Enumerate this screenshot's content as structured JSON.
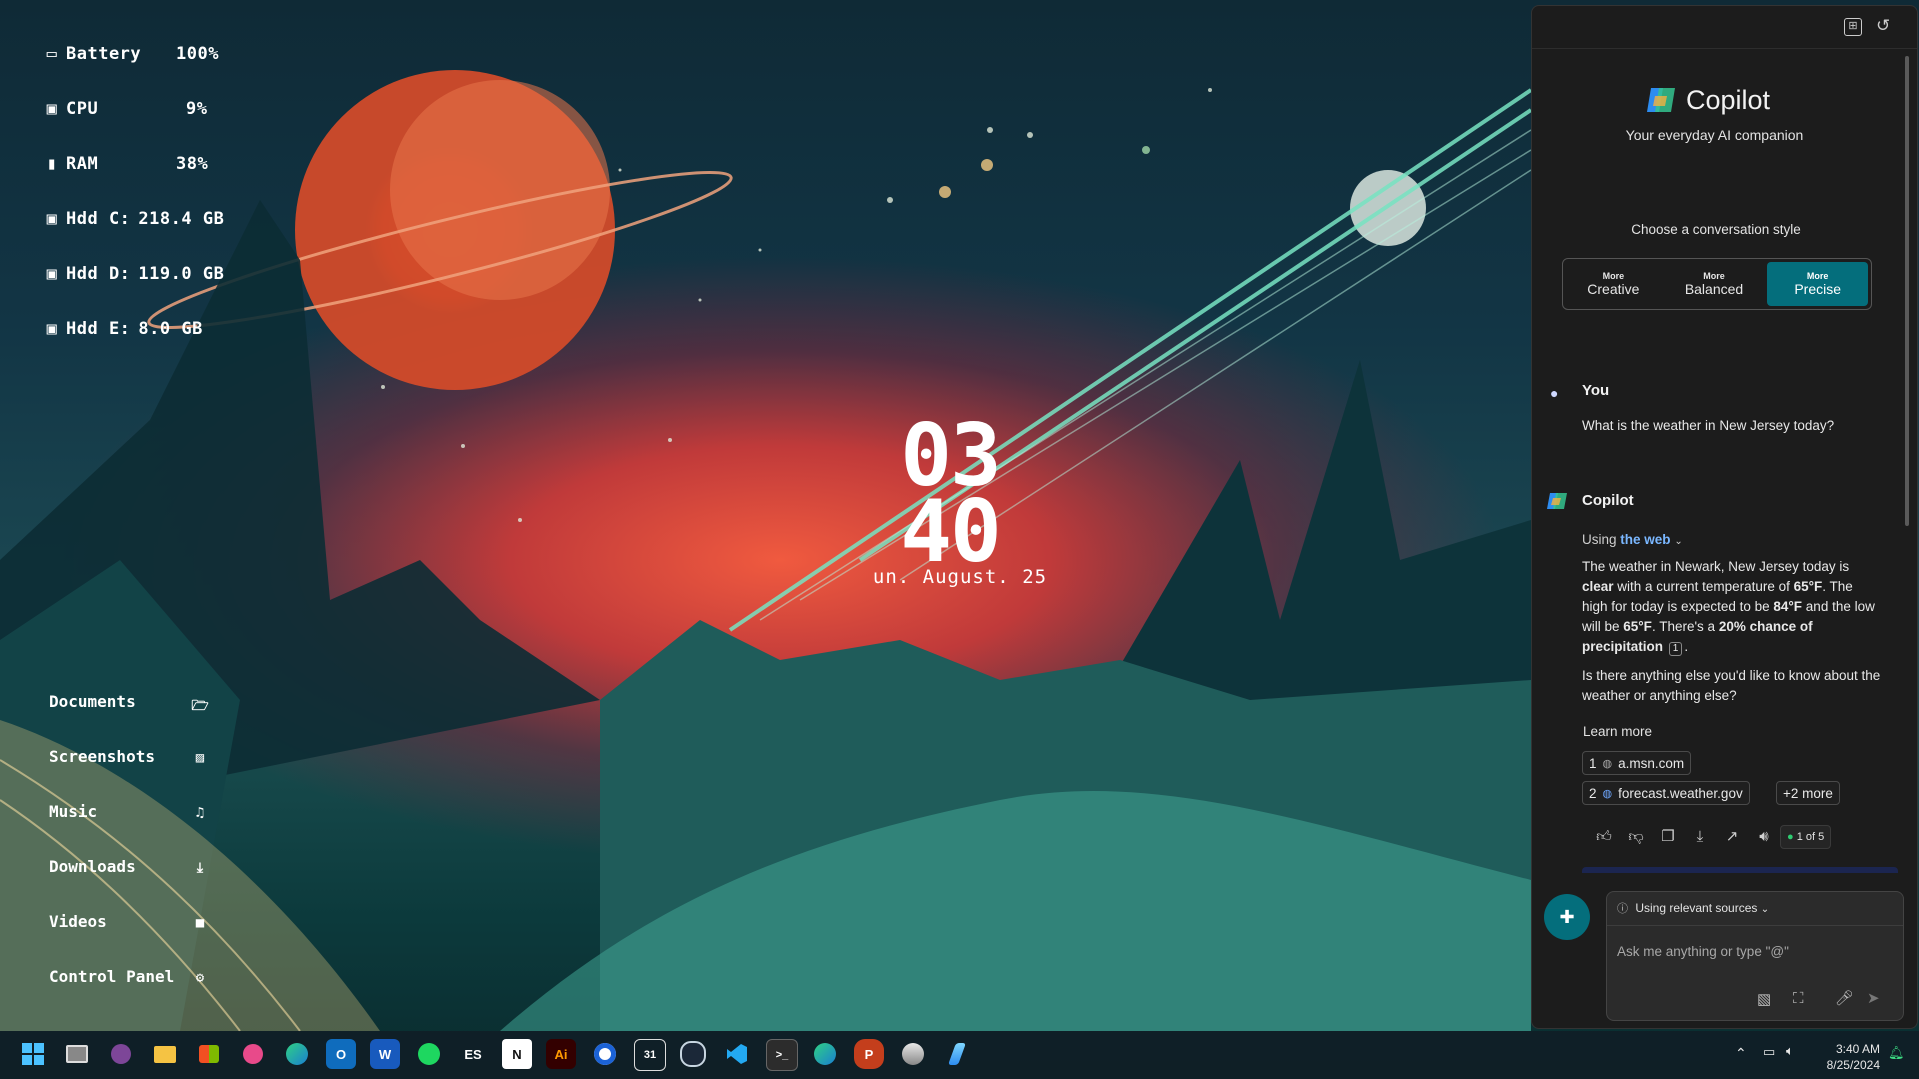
{
  "desktop": {
    "stats": [
      {
        "icon": "battery-icon",
        "label": "Battery",
        "value": "100%"
      },
      {
        "icon": "cpu-icon",
        "label": "CPU",
        "value": "9%"
      },
      {
        "icon": "ram-icon",
        "label": "RAM",
        "value": "38%"
      },
      {
        "icon": "drive-icon",
        "label": "Hdd C:",
        "value": "218.4 GB"
      },
      {
        "icon": "drive-icon",
        "label": "Hdd D:",
        "value": "119.0 GB"
      },
      {
        "icon": "drive-icon",
        "label": "Hdd E:",
        "value": "8.0 GB"
      }
    ],
    "clock": {
      "hour": "03",
      "minute": "40",
      "date": "un. August. 25"
    },
    "folders": [
      {
        "label": "Documents",
        "icon": "folder-open-icon"
      },
      {
        "label": "Screenshots",
        "icon": "image-icon"
      },
      {
        "label": "Music",
        "icon": "music-note-icon"
      },
      {
        "label": "Downloads",
        "icon": "download-icon"
      },
      {
        "label": "Videos",
        "icon": "video-camera-icon"
      },
      {
        "label": "Control Panel",
        "icon": "gear-icon"
      }
    ]
  },
  "copilot": {
    "title": "Copilot",
    "tagline": "Your everyday AI companion",
    "style_prompt": "Choose a conversation style",
    "styles": [
      {
        "small": "More",
        "label": "Creative",
        "active": false
      },
      {
        "small": "More",
        "label": "Balanced",
        "active": false
      },
      {
        "small": "More",
        "label": "Precise",
        "active": true
      }
    ],
    "user_name": "You",
    "user_message": "What is the weather in New Jersey today?",
    "bot_name": "Copilot",
    "using_prefix": "Using",
    "using_link": "the web",
    "answer": {
      "p1_a": "The weather in Newark, New Jersey today is ",
      "p1_clear": "clear",
      "p1_b": " with a current temperature of ",
      "p1_temp": "65°F",
      "p1_c": ". The high for today is expected to be ",
      "p1_high": "84°F",
      "p1_d": " and the low will be ",
      "p1_low": "65°F",
      "p1_e": ". There's a ",
      "p1_rain": "20% chance of precipitation",
      "p1_cite": "1",
      "p1_end": ".",
      "p2": "Is there anything else you'd like to know about the weather or anything else?"
    },
    "learn_more": "Learn more",
    "sources": [
      {
        "num": "1",
        "domain": "a.msn.com"
      },
      {
        "num": "2",
        "domain": "forecast.weather.gov"
      }
    ],
    "more_sources": "+2 more",
    "response_counter": "1 of 5",
    "input_sources_label": "Using relevant sources",
    "input_placeholder": "Ask me anything or type \"@\""
  },
  "taskbar": {
    "apps": [
      "start",
      "task-view",
      "tor",
      "file-explorer",
      "store",
      "paint",
      "edge-beta",
      "outlook",
      "word",
      "spotify",
      "es",
      "notion",
      "illustrator",
      "messenger",
      "calendar",
      "steam",
      "vscode",
      "terminal",
      "edge-beta-2",
      "powerpoint",
      "globe",
      "copilot"
    ],
    "illustrator_label": "Ai",
    "es_label": "ES",
    "notion_label": "N",
    "calendar_label": "31",
    "word_label": "W",
    "outlook_label": "O",
    "powerpoint_label": "P",
    "time": "3:40 AM",
    "date": "8/25/2024"
  },
  "colors": {
    "accent": "#046e7c",
    "link": "#7ab7ff",
    "online_dot": "#2ecc71"
  }
}
